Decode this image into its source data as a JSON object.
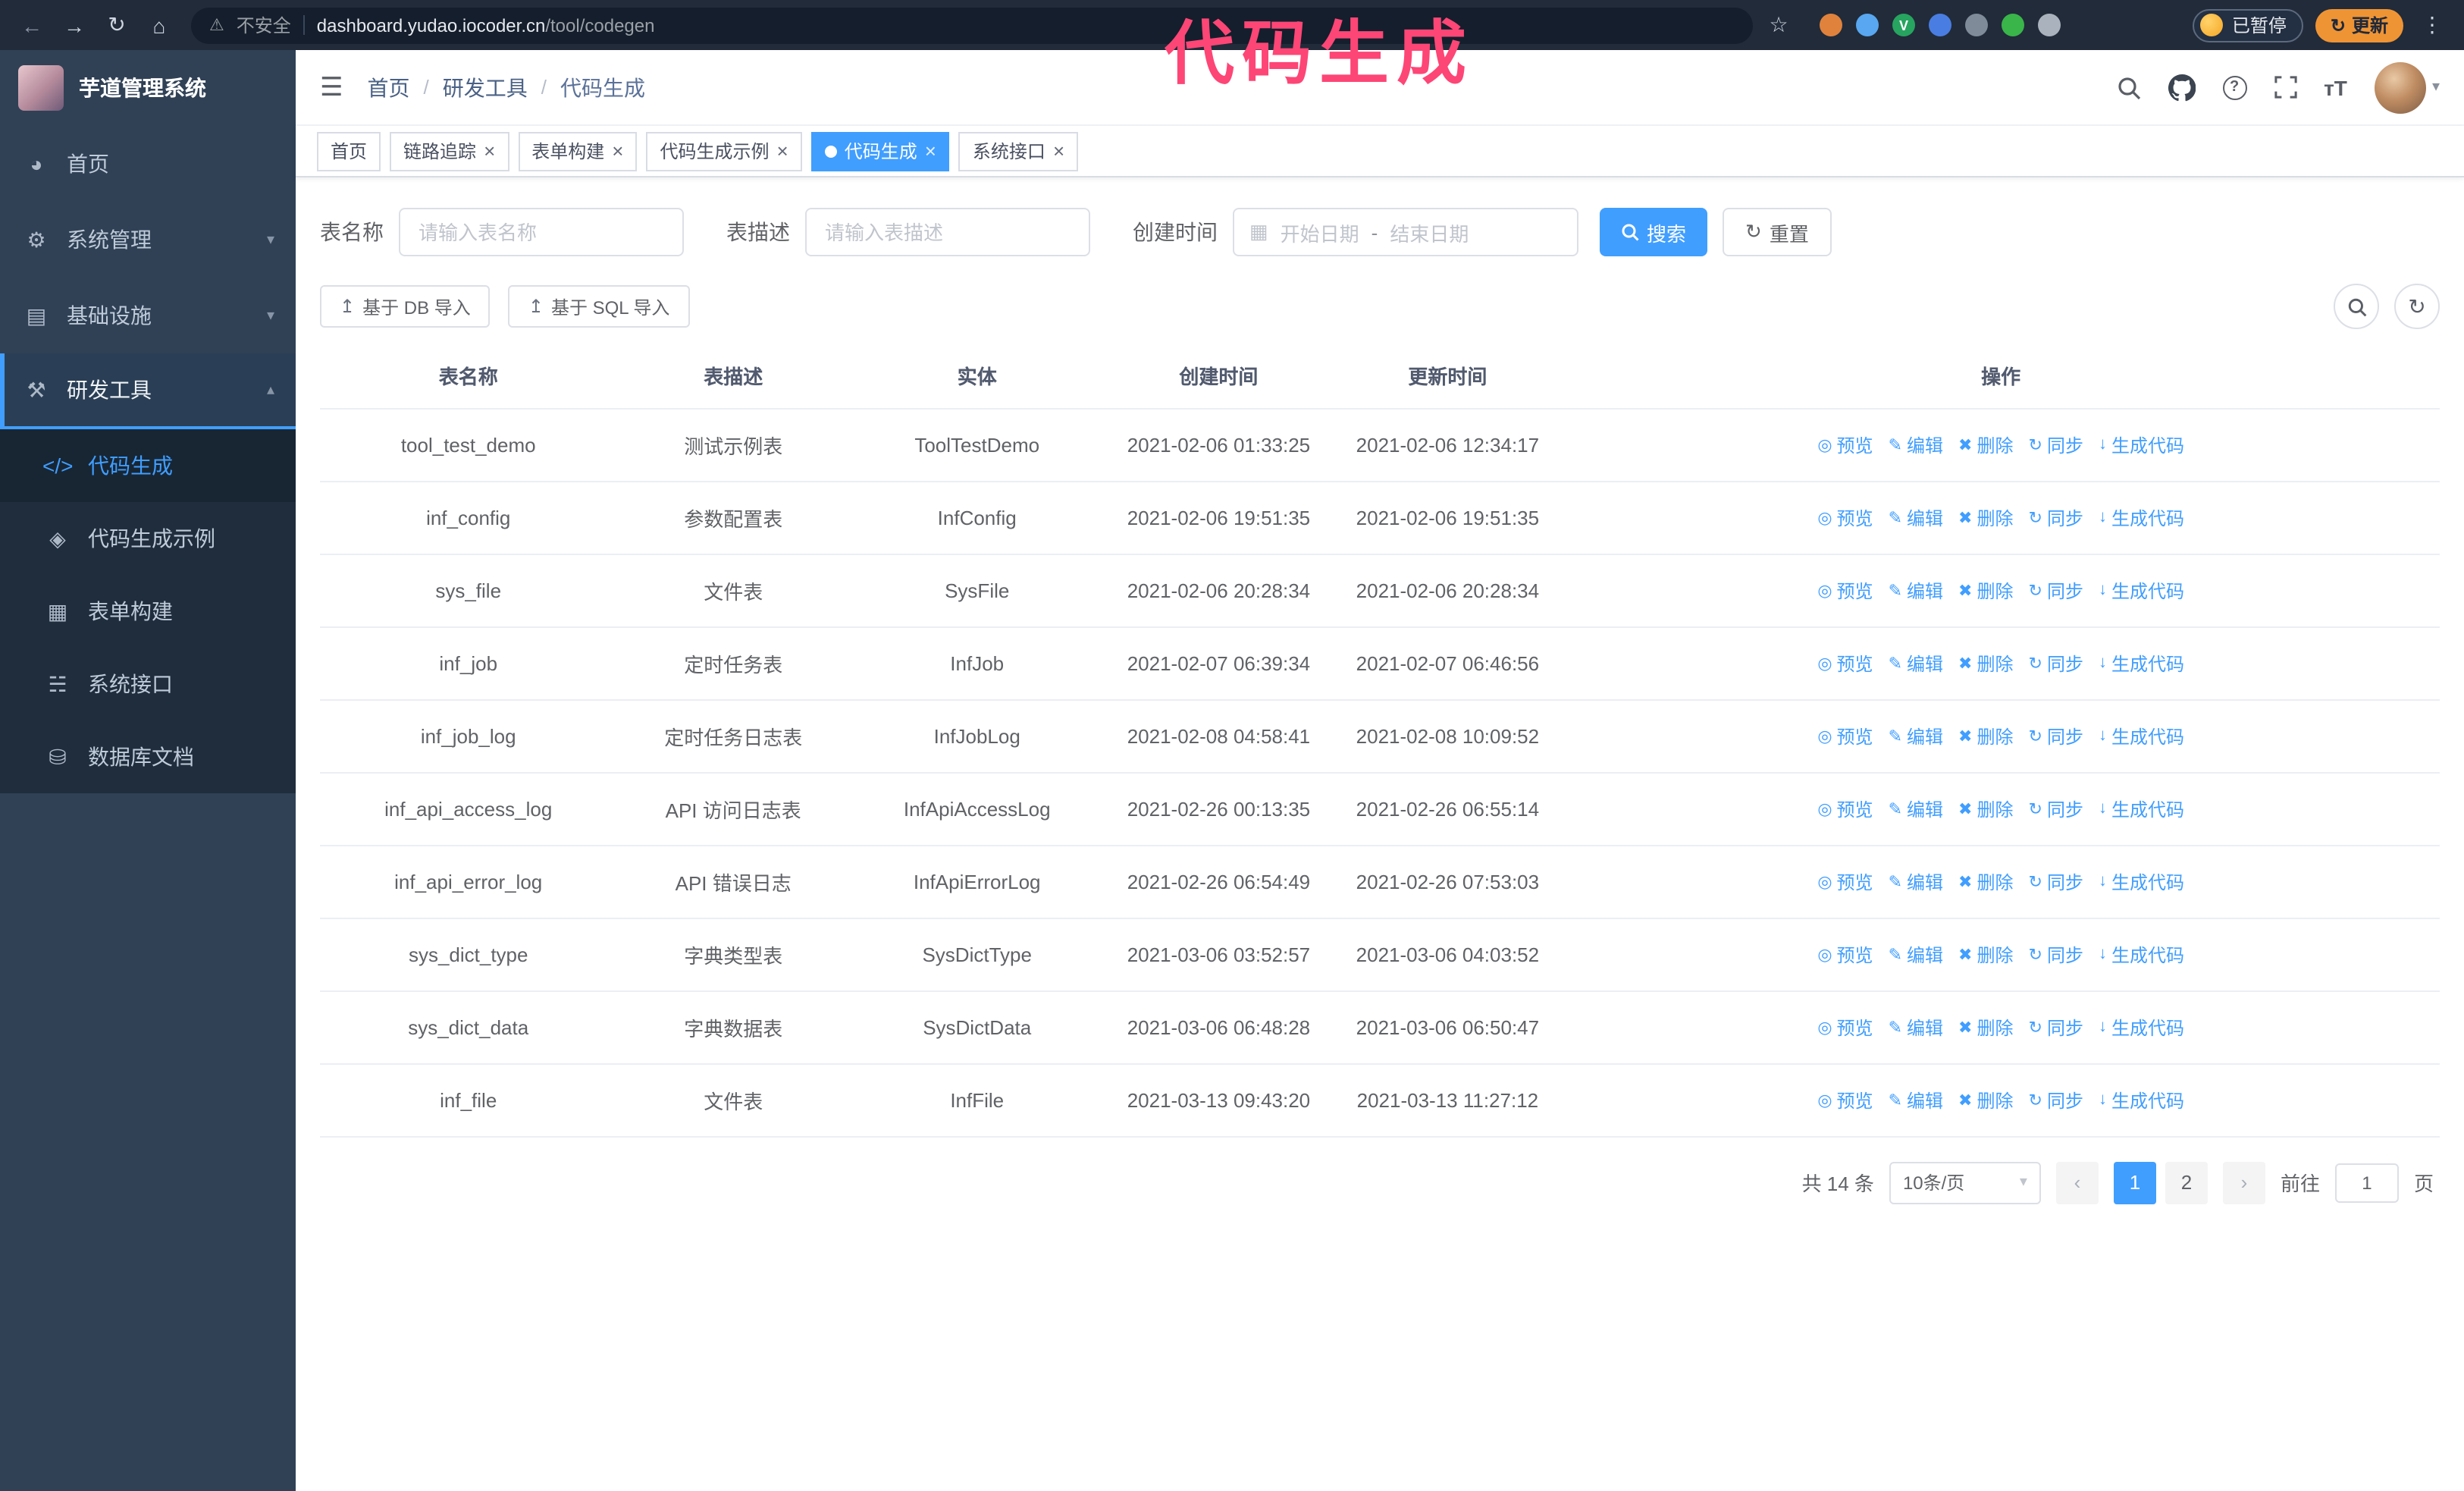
{
  "colors": {
    "accent": "#409eff",
    "annotation": "#fd4676",
    "sidebar_bg": "#304156",
    "submenu_bg": "#1f2d3d",
    "browser_bar_bg": "#212b3a",
    "update_orange": "#ef9434"
  },
  "browser": {
    "security_label": "不安全",
    "url_host": "dashboard.yudao.iocoder.cn",
    "url_path": "/tool/codegen",
    "paused_label": "已暂停",
    "update_label": "更新",
    "extensions": [
      {
        "color": "#e0823c"
      },
      {
        "color": "#58a7f0"
      },
      {
        "color": "#27a45f",
        "letter": "V"
      },
      {
        "color": "#4a7de2"
      },
      {
        "color": "#7f8b99"
      },
      {
        "color": "#39b54a"
      },
      {
        "color": "#aab2bd"
      }
    ]
  },
  "annotation": {
    "text": "代码生成"
  },
  "sidebar": {
    "logo_title": "芋道管理系统",
    "items": [
      {
        "id": "home",
        "label": "首页",
        "icon": "◕"
      },
      {
        "id": "system",
        "label": "系统管理",
        "icon": "⚙",
        "caret": "▾"
      },
      {
        "id": "infra",
        "label": "基础设施",
        "icon": "▤",
        "caret": "▾"
      },
      {
        "id": "devtools",
        "label": "研发工具",
        "icon": "⚒",
        "caret": "▴",
        "expanded": true,
        "children": [
          {
            "id": "codegen",
            "label": "代码生成",
            "icon": "</>",
            "active": true
          },
          {
            "id": "codegen-example",
            "label": "代码生成示例",
            "icon": "◈"
          },
          {
            "id": "form-builder",
            "label": "表单构建",
            "icon": "▦"
          },
          {
            "id": "system-api",
            "label": "系统接口",
            "icon": "☵"
          },
          {
            "id": "db-doc",
            "label": "数据库文档",
            "icon": "⛁"
          }
        ]
      }
    ]
  },
  "header": {
    "breadcrumb": [
      "首页",
      "研发工具",
      "代码生成"
    ],
    "separator": "/"
  },
  "tabs": [
    {
      "id": "home",
      "label": "首页",
      "closable": false
    },
    {
      "id": "tracer",
      "label": "链路追踪",
      "closable": true
    },
    {
      "id": "form-builder",
      "label": "表单构建",
      "closable": true
    },
    {
      "id": "codegen-example",
      "label": "代码生成示例",
      "closable": true
    },
    {
      "id": "codegen",
      "label": "代码生成",
      "closable": true,
      "active": true
    },
    {
      "id": "system-api",
      "label": "系统接口",
      "closable": true
    }
  ],
  "filters": {
    "table_name_label": "表名称",
    "table_name_placeholder": "请输入表名称",
    "table_desc_label": "表描述",
    "table_desc_placeholder": "请输入表描述",
    "create_time_label": "创建时间",
    "date_start_placeholder": "开始日期",
    "date_separator": "-",
    "date_end_placeholder": "结束日期",
    "search_button": "搜索",
    "reset_button": "重置"
  },
  "toolbar": {
    "import_db": "基于 DB 导入",
    "import_sql": "基于 SQL 导入"
  },
  "table": {
    "columns": [
      "表名称",
      "表描述",
      "实体",
      "创建时间",
      "更新时间",
      "操作"
    ],
    "actions": [
      {
        "id": "preview",
        "label": "预览",
        "icon": "◎"
      },
      {
        "id": "edit",
        "label": "编辑",
        "icon": "✎"
      },
      {
        "id": "delete",
        "label": "删除",
        "icon": "✖"
      },
      {
        "id": "sync",
        "label": "同步",
        "icon": "↻"
      },
      {
        "id": "generate",
        "label": "生成代码",
        "icon": "↓"
      }
    ],
    "rows": [
      {
        "name": "tool_test_demo",
        "desc": "测试示例表",
        "entity": "ToolTestDemo",
        "created": "2021-02-06 01:33:25",
        "updated": "2021-02-06 12:34:17"
      },
      {
        "name": "inf_config",
        "desc": "参数配置表",
        "entity": "InfConfig",
        "created": "2021-02-06 19:51:35",
        "updated": "2021-02-06 19:51:35"
      },
      {
        "name": "sys_file",
        "desc": "文件表",
        "entity": "SysFile",
        "created": "2021-02-06 20:28:34",
        "updated": "2021-02-06 20:28:34"
      },
      {
        "name": "inf_job",
        "desc": "定时任务表",
        "entity": "InfJob",
        "created": "2021-02-07 06:39:34",
        "updated": "2021-02-07 06:46:56"
      },
      {
        "name": "inf_job_log",
        "desc": "定时任务日志表",
        "entity": "InfJobLog",
        "created": "2021-02-08 04:58:41",
        "updated": "2021-02-08 10:09:52"
      },
      {
        "name": "inf_api_access_log",
        "desc": "API 访问日志表",
        "entity": "InfApiAccessLog",
        "created": "2021-02-26 00:13:35",
        "updated": "2021-02-26 06:55:14"
      },
      {
        "name": "inf_api_error_log",
        "desc": "API 错误日志",
        "entity": "InfApiErrorLog",
        "created": "2021-02-26 06:54:49",
        "updated": "2021-02-26 07:53:03"
      },
      {
        "name": "sys_dict_type",
        "desc": "字典类型表",
        "entity": "SysDictType",
        "created": "2021-03-06 03:52:57",
        "updated": "2021-03-06 04:03:52"
      },
      {
        "name": "sys_dict_data",
        "desc": "字典数据表",
        "entity": "SysDictData",
        "created": "2021-03-06 06:48:28",
        "updated": "2021-03-06 06:50:47"
      },
      {
        "name": "inf_file",
        "desc": "文件表",
        "entity": "InfFile",
        "created": "2021-03-13 09:43:20",
        "updated": "2021-03-13 11:27:12"
      }
    ]
  },
  "pagination": {
    "total": "共 14 条",
    "page_size": "10条/页",
    "pages": [
      "1",
      "2"
    ],
    "current": "1",
    "goto_label": "前往",
    "goto_value": "1",
    "goto_suffix": "页"
  },
  "icons": {
    "back": "←",
    "forward": "→",
    "reload": "↻",
    "home": "⌂",
    "warning": "⚠",
    "star": "☆",
    "dots": "⋮",
    "hamburger": "☰",
    "caret_down": "▾",
    "calendar": "▦",
    "upload": "↥",
    "prev": "‹",
    "next": "›",
    "close": "×",
    "question": "?",
    "font_size": "тT"
  }
}
